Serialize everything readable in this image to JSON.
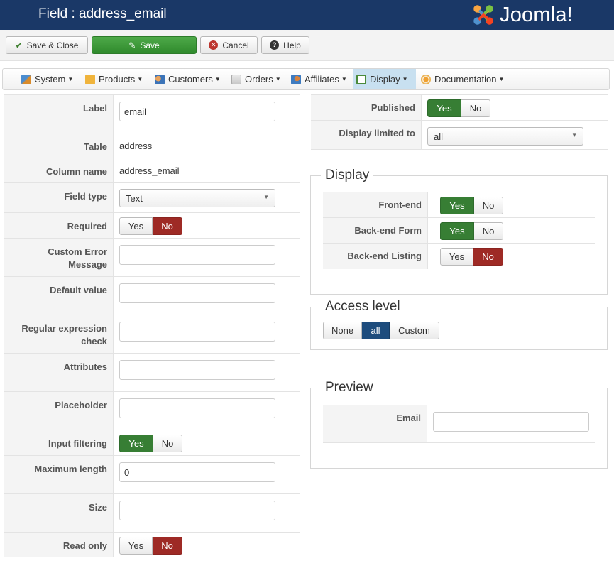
{
  "header": {
    "title": "Field : address_email",
    "brand": "Joomla!"
  },
  "toolbar": {
    "save_close": "Save & Close",
    "save": "Save",
    "cancel": "Cancel",
    "help": "Help"
  },
  "menu": {
    "items": [
      {
        "label": "System",
        "icon": "tools-icon"
      },
      {
        "label": "Products",
        "icon": "products-icon"
      },
      {
        "label": "Customers",
        "icon": "customers-icon"
      },
      {
        "label": "Orders",
        "icon": "orders-icon"
      },
      {
        "label": "Affiliates",
        "icon": "affiliates-icon"
      },
      {
        "label": "Display",
        "icon": "display-icon",
        "active": true
      },
      {
        "label": "Documentation",
        "icon": "documentation-icon"
      }
    ]
  },
  "form": {
    "label": {
      "label": "Label",
      "value": "email"
    },
    "table": {
      "label": "Table",
      "value": "address"
    },
    "column_name": {
      "label": "Column name",
      "value": "address_email"
    },
    "field_type": {
      "label": "Field type",
      "value": "Text"
    },
    "required": {
      "label": "Required",
      "yes": "Yes",
      "no": "No",
      "selected": "No"
    },
    "custom_error": {
      "label_line1": "Custom Error",
      "label_line2": "Message",
      "value": ""
    },
    "default_value": {
      "label": "Default value",
      "value": ""
    },
    "regex": {
      "label_line1": "Regular expression",
      "label_line2": "check",
      "value": ""
    },
    "attributes": {
      "label": "Attributes",
      "value": ""
    },
    "placeholder": {
      "label": "Placeholder",
      "value": ""
    },
    "input_filtering": {
      "label": "Input filtering",
      "yes": "Yes",
      "no": "No",
      "selected": "Yes"
    },
    "maximum_length": {
      "label": "Maximum length",
      "value": "0"
    },
    "size": {
      "label": "Size",
      "value": ""
    },
    "read_only": {
      "label": "Read only",
      "yes": "Yes",
      "no": "No",
      "selected": "No"
    }
  },
  "right": {
    "published": {
      "label": "Published",
      "yes": "Yes",
      "no": "No",
      "selected": "Yes"
    },
    "display_limited": {
      "label": "Display limited to",
      "value": "all"
    },
    "display": {
      "legend": "Display",
      "frontend": {
        "label": "Front-end",
        "yes": "Yes",
        "no": "No",
        "selected": "Yes"
      },
      "backend_form": {
        "label": "Back-end Form",
        "yes": "Yes",
        "no": "No",
        "selected": "Yes"
      },
      "backend_listing": {
        "label": "Back-end Listing",
        "yes": "Yes",
        "no": "No",
        "selected": "No"
      }
    },
    "access": {
      "legend": "Access level",
      "none": "None",
      "all": "all",
      "custom": "Custom",
      "selected": "all"
    },
    "preview": {
      "legend": "Preview",
      "email_label": "Email",
      "email_value": ""
    }
  },
  "colors": {
    "header_bg": "#1a3867",
    "yes_green": "#377e34",
    "no_red": "#9e2a25",
    "selected_blue": "#1d4c7d",
    "active_menu": "#c8e0f0"
  }
}
